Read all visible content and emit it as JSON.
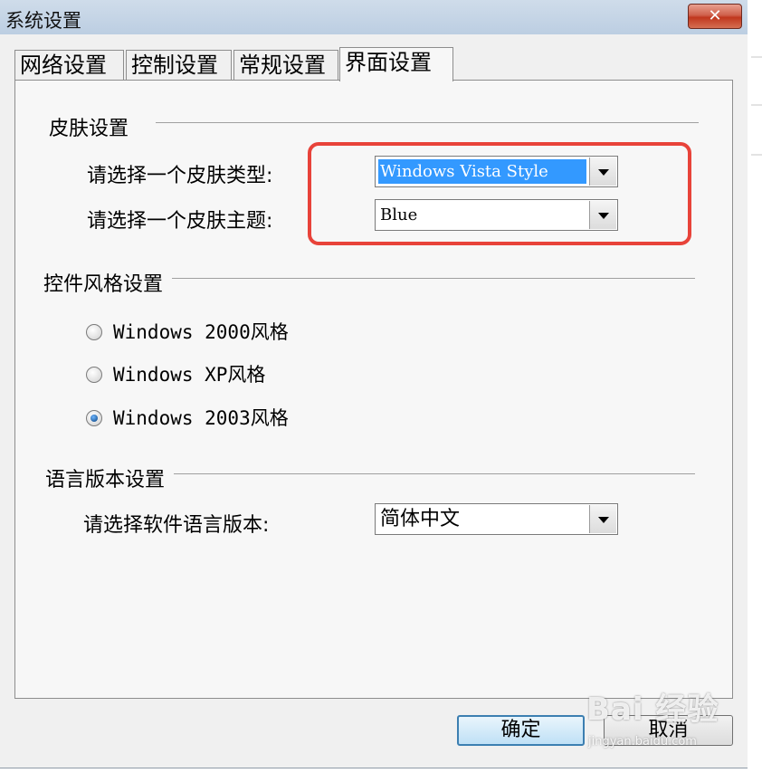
{
  "window": {
    "title": "系统设置",
    "close_symbol": "✕"
  },
  "tabs": [
    {
      "label": "网络设置",
      "active": false
    },
    {
      "label": "控制设置",
      "active": false
    },
    {
      "label": "常规设置",
      "active": false
    },
    {
      "label": "界面设置",
      "active": true
    }
  ],
  "skin_group": {
    "title": "皮肤设置",
    "type_label": "请选择一个皮肤类型:",
    "type_value": "Windows Vista Style",
    "theme_label": "请选择一个皮肤主题:",
    "theme_value": "Blue"
  },
  "control_group": {
    "title": "控件风格设置",
    "options": [
      {
        "label": "Windows 2000风格",
        "checked": false
      },
      {
        "label": "Windows XP风格",
        "checked": false
      },
      {
        "label": "Windows 2003风格",
        "checked": true
      }
    ]
  },
  "language_group": {
    "title": "语言版本设置",
    "label": "请选择软件语言版本:",
    "value": "简体中文"
  },
  "buttons": {
    "ok": "确定",
    "cancel": "取消"
  },
  "watermark": {
    "brand": "Bai 经验",
    "url": "jingyan.baidu.com"
  },
  "colors": {
    "highlight": "#e8433a",
    "selection": "#3399ff",
    "title_bar": "#c5d5e8"
  }
}
